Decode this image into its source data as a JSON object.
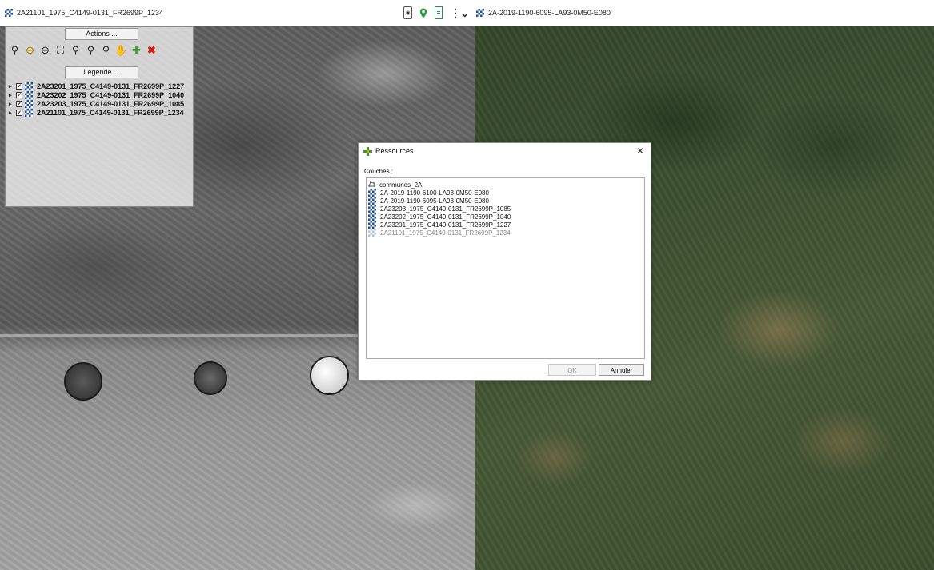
{
  "left_view": {
    "title": "2A21101_1975_C4149-0131_FR2699P_1234"
  },
  "right_view": {
    "title": "2A-2019-1190-6095-LA93-0M50-E080"
  },
  "toolbar": {
    "icons": [
      "target-icon",
      "location-pin-icon",
      "document-icon",
      "more-options-icon"
    ]
  },
  "panel": {
    "actions_label": "Actions ...",
    "legende_label": "Legende ...",
    "action_icons": [
      "zoom-icon",
      "zoom-in-icon",
      "zoom-out-icon",
      "zoom-extent-icon",
      "zoom-layer-icon",
      "zoom-previous-icon",
      "zoom-next-icon",
      "pan-hand-icon",
      "add-layer-icon",
      "remove-layer-icon"
    ],
    "legend_items": [
      {
        "label": "2A23201_1975_C4149-0131_FR2699P_1227",
        "checked": true
      },
      {
        "label": "2A23202_1975_C4149-0131_FR2699P_1040",
        "checked": true
      },
      {
        "label": "2A23203_1975_C4149-0131_FR2699P_1085",
        "checked": true
      },
      {
        "label": "2A21101_1975_C4149-0131_FR2699P_1234",
        "checked": true
      }
    ]
  },
  "dialog": {
    "title": "Ressources",
    "close_label": "✕",
    "couches_label": "Couches :",
    "items": [
      {
        "label": "communes_2A",
        "type": "vector",
        "enabled": true
      },
      {
        "label": "2A-2019-1190-6100-LA93-0M50-E080",
        "type": "raster",
        "enabled": true
      },
      {
        "label": "2A-2019-1190-6095-LA93-0M50-E080",
        "type": "raster",
        "enabled": true
      },
      {
        "label": "2A23203_1975_C4149-0131_FR2699P_1085",
        "type": "raster",
        "enabled": true
      },
      {
        "label": "2A23202_1975_C4149-0131_FR2699P_1040",
        "type": "raster",
        "enabled": true
      },
      {
        "label": "2A23201_1975_C4149-0131_FR2699P_1227",
        "type": "raster",
        "enabled": true
      },
      {
        "label": "2A21101_1975_C4149-0131_FR2699P_1234",
        "type": "raster",
        "enabled": false
      }
    ],
    "ok_label": "OK",
    "cancel_label": "Annuler"
  }
}
